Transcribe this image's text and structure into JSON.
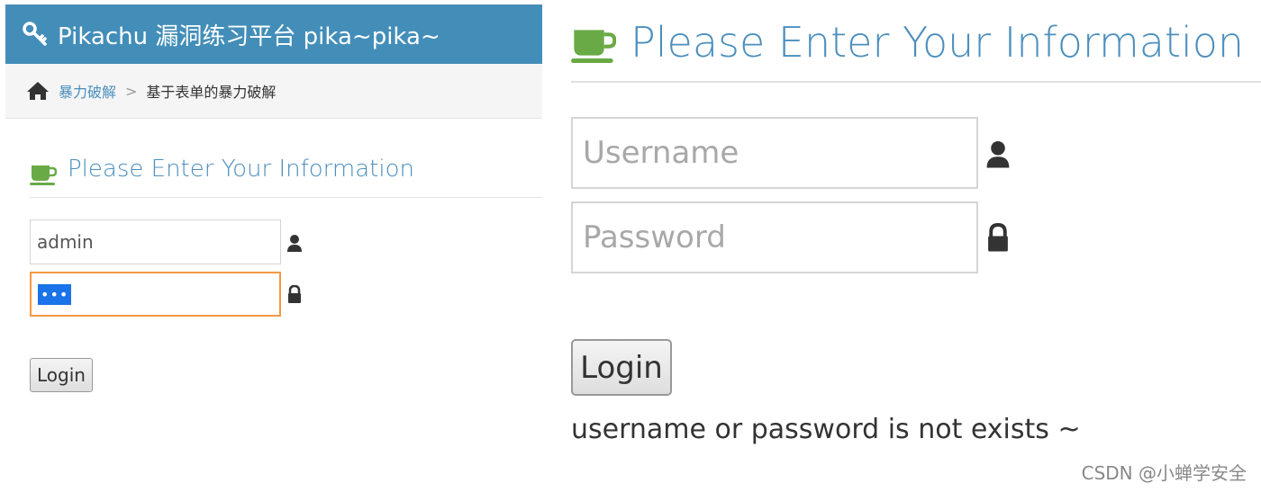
{
  "left_panel": {
    "header": {
      "title": "Pikachu 漏洞练习平台 pika~pika~",
      "icon": "key-icon"
    },
    "breadcrumb": {
      "home_icon": "home-icon",
      "link": "暴力破解",
      "separator": ">",
      "current": "基于表单的暴力破解"
    },
    "form": {
      "title": "Please Enter Your Information",
      "title_icon": "coffee-icon",
      "username_value": "admin",
      "password_value": "•••",
      "login_label": "Login"
    }
  },
  "right_panel": {
    "form": {
      "title": "Please Enter Your Information",
      "title_icon": "coffee-icon",
      "username_placeholder": "Username",
      "password_placeholder": "Password",
      "login_label": "Login",
      "error_message": "username or password is not exists ~"
    },
    "watermark": "CSDN @小蝉学安全"
  },
  "colors": {
    "header_bg": "#438eb9",
    "title": "#4c8fbd",
    "coffee": "#69aa46",
    "focus_border": "#f59942"
  }
}
